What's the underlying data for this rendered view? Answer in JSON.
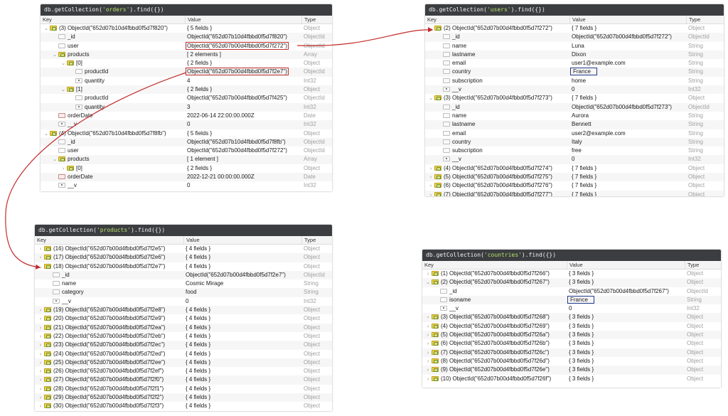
{
  "colors": {
    "accent_red": "#c22c2c",
    "accent_blue": "#1f3a8c",
    "query_bar": "#3b3d40"
  },
  "headers": {
    "key": "Key",
    "value": "Value",
    "type": "Type"
  },
  "orders": {
    "query_prefix": "db.getCollection(",
    "query_name": "'orders'",
    "query_suffix": ").find({})",
    "rows": [
      {
        "depth": 0,
        "arrow": "⌄",
        "icon": "doc",
        "key": "(3) ObjectId(\"652d07b10d4fbbd0f5d7f820\")",
        "value": "{ 5 fields }",
        "type": "Object"
      },
      {
        "depth": 1,
        "arrow": "",
        "icon": "field",
        "key": "_id",
        "value": "ObjectId(\"652d07b10d4fbbd0f5d7f820\")",
        "type": "ObjectId"
      },
      {
        "depth": 1,
        "arrow": "",
        "icon": "field",
        "key": "user",
        "value": "ObjectId(\"652d07b00d4fbbd0f5d7f272\")",
        "type": "ObjectId",
        "hl": "red"
      },
      {
        "depth": 1,
        "arrow": "⌄",
        "icon": "arr",
        "key": "products",
        "value": "[ 2 elements ]",
        "type": "Array"
      },
      {
        "depth": 2,
        "arrow": "⌄",
        "icon": "doc",
        "key": "[0]",
        "value": "{ 2 fields }",
        "type": "Object"
      },
      {
        "depth": 3,
        "arrow": "",
        "icon": "field",
        "key": "productId",
        "value": "ObjectId(\"652d07b00d4fbbd0f5d7f2e7\")",
        "type": "ObjectId",
        "hl": "red"
      },
      {
        "depth": 3,
        "arrow": "",
        "icon": "num",
        "key": "quantity",
        "value": "4",
        "type": "Int32"
      },
      {
        "depth": 2,
        "arrow": "⌄",
        "icon": "doc",
        "key": "[1]",
        "value": "{ 2 fields }",
        "type": "Object"
      },
      {
        "depth": 3,
        "arrow": "",
        "icon": "field",
        "key": "productId",
        "value": "ObjectId(\"652d07b00d4fbbd0f5d7f425\")",
        "type": "ObjectId"
      },
      {
        "depth": 3,
        "arrow": "",
        "icon": "num",
        "key": "quantity",
        "value": "3",
        "type": "Int32"
      },
      {
        "depth": 1,
        "arrow": "",
        "icon": "date",
        "key": "orderDate",
        "value": "2022-06-14 22:00:00.000Z",
        "type": "Date"
      },
      {
        "depth": 1,
        "arrow": "",
        "icon": "num",
        "key": "__v",
        "value": "0",
        "type": "Int32"
      },
      {
        "depth": 0,
        "arrow": "⌄",
        "icon": "doc",
        "key": "(4) ObjectId(\"652d07b10d4fbbd0f5d7f8fb\")",
        "value": "{ 5 fields }",
        "type": "Object"
      },
      {
        "depth": 1,
        "arrow": "",
        "icon": "field",
        "key": "_id",
        "value": "ObjectId(\"652d07b10d4fbbd0f5d7f8fb\")",
        "type": "ObjectId"
      },
      {
        "depth": 1,
        "arrow": "",
        "icon": "field",
        "key": "user",
        "value": "ObjectId(\"652d07b00d4fbbd0f5d7f272\")",
        "type": "ObjectId"
      },
      {
        "depth": 1,
        "arrow": "⌄",
        "icon": "arr",
        "key": "products",
        "value": "[ 1 element ]",
        "type": "Array"
      },
      {
        "depth": 2,
        "arrow": "›",
        "icon": "doc",
        "key": "[0]",
        "value": "{ 2 fields }",
        "type": "Object"
      },
      {
        "depth": 1,
        "arrow": "",
        "icon": "date",
        "key": "orderDate",
        "value": "2022-12-21 00:00:00.000Z",
        "type": "Date"
      },
      {
        "depth": 1,
        "arrow": "",
        "icon": "num",
        "key": "__v",
        "value": "0",
        "type": "Int32"
      }
    ]
  },
  "users": {
    "query_prefix": "db.getCollection(",
    "query_name": "'users'",
    "query_suffix": ").find({})",
    "rows": [
      {
        "depth": 0,
        "arrow": "⌄",
        "icon": "doc",
        "key": "(2) ObjectId(\"652d07b00d4fbbd0f5d7f272\")",
        "value": "{ 7 fields }",
        "type": "Object"
      },
      {
        "depth": 1,
        "arrow": "",
        "icon": "field",
        "key": "_id",
        "value": "ObjectId(\"652d07b00d4fbbd0f5d7f272\")",
        "type": "ObjectId"
      },
      {
        "depth": 1,
        "arrow": "",
        "icon": "field",
        "key": "name",
        "value": "Luna",
        "type": "String"
      },
      {
        "depth": 1,
        "arrow": "",
        "icon": "field",
        "key": "lastname",
        "value": "Dixon",
        "type": "String"
      },
      {
        "depth": 1,
        "arrow": "",
        "icon": "field",
        "key": "email",
        "value": "user1@example.com",
        "type": "String"
      },
      {
        "depth": 1,
        "arrow": "",
        "icon": "field",
        "key": "country",
        "value": "France",
        "type": "String",
        "hl": "blue"
      },
      {
        "depth": 1,
        "arrow": "",
        "icon": "field",
        "key": "subscription",
        "value": "home",
        "type": "String"
      },
      {
        "depth": 1,
        "arrow": "",
        "icon": "num",
        "key": "__v",
        "value": "0",
        "type": "Int32"
      },
      {
        "depth": 0,
        "arrow": "⌄",
        "icon": "doc",
        "key": "(3) ObjectId(\"652d07b00d4fbbd0f5d7f273\")",
        "value": "{ 7 fields }",
        "type": "Object"
      },
      {
        "depth": 1,
        "arrow": "",
        "icon": "field",
        "key": "_id",
        "value": "ObjectId(\"652d07b00d4fbbd0f5d7f273\")",
        "type": "ObjectId"
      },
      {
        "depth": 1,
        "arrow": "",
        "icon": "field",
        "key": "name",
        "value": "Aurora",
        "type": "String"
      },
      {
        "depth": 1,
        "arrow": "",
        "icon": "field",
        "key": "lastname",
        "value": "Bennett",
        "type": "String"
      },
      {
        "depth": 1,
        "arrow": "",
        "icon": "field",
        "key": "email",
        "value": "user2@example.com",
        "type": "String"
      },
      {
        "depth": 1,
        "arrow": "",
        "icon": "field",
        "key": "country",
        "value": "Italy",
        "type": "String"
      },
      {
        "depth": 1,
        "arrow": "",
        "icon": "field",
        "key": "subscription",
        "value": "free",
        "type": "String"
      },
      {
        "depth": 1,
        "arrow": "",
        "icon": "num",
        "key": "__v",
        "value": "0",
        "type": "Int32"
      },
      {
        "depth": 0,
        "arrow": "›",
        "icon": "doc",
        "key": "(4) ObjectId(\"652d07b00d4fbbd0f5d7f274\")",
        "value": "{ 7 fields }",
        "type": "Object"
      },
      {
        "depth": 0,
        "arrow": "›",
        "icon": "doc",
        "key": "(5) ObjectId(\"652d07b00d4fbbd0f5d7f275\")",
        "value": "{ 7 fields }",
        "type": "Object"
      },
      {
        "depth": 0,
        "arrow": "›",
        "icon": "doc",
        "key": "(6) ObjectId(\"652d07b00d4fbbd0f5d7f276\")",
        "value": "{ 7 fields }",
        "type": "Object"
      },
      {
        "depth": 0,
        "arrow": "›",
        "icon": "doc",
        "key": "(7) ObjectId(\"652d07b00d4fbbd0f5d7f277\")",
        "value": "{ 7 fields }",
        "type": "Object"
      }
    ]
  },
  "products": {
    "query_prefix": "db.getCollection(",
    "query_name": "'products'",
    "query_suffix": ").find({})",
    "rows": [
      {
        "depth": 0,
        "arrow": "›",
        "icon": "doc",
        "key": "(16) ObjectId(\"652d07b00d4fbbd0f5d7f2e5\")",
        "value": "{ 4 fields }",
        "type": "Object"
      },
      {
        "depth": 0,
        "arrow": "›",
        "icon": "doc",
        "key": "(17) ObjectId(\"652d07b00d4fbbd0f5d7f2e6\")",
        "value": "{ 4 fields }",
        "type": "Object"
      },
      {
        "depth": 0,
        "arrow": "⌄",
        "icon": "doc",
        "key": "(18) ObjectId(\"652d07b00d4fbbd0f5d7f2e7\")",
        "value": "{ 4 fields }",
        "type": "Object"
      },
      {
        "depth": 1,
        "arrow": "",
        "icon": "field",
        "key": "_id",
        "value": "ObjectId(\"652d07b00d4fbbd0f5d7f2e7\")",
        "type": "ObjectId"
      },
      {
        "depth": 1,
        "arrow": "",
        "icon": "field",
        "key": "name",
        "value": "Cosmic Mirage",
        "type": "String"
      },
      {
        "depth": 1,
        "arrow": "",
        "icon": "field",
        "key": "category",
        "value": "food",
        "type": "String"
      },
      {
        "depth": 1,
        "arrow": "",
        "icon": "num",
        "key": "__v",
        "value": "0",
        "type": "Int32"
      },
      {
        "depth": 0,
        "arrow": "›",
        "icon": "doc",
        "key": "(19) ObjectId(\"652d07b00d4fbbd0f5d7f2e8\")",
        "value": "{ 4 fields }",
        "type": "Object"
      },
      {
        "depth": 0,
        "arrow": "›",
        "icon": "doc",
        "key": "(20) ObjectId(\"652d07b00d4fbbd0f5d7f2e9\")",
        "value": "{ 4 fields }",
        "type": "Object"
      },
      {
        "depth": 0,
        "arrow": "›",
        "icon": "doc",
        "key": "(21) ObjectId(\"652d07b00d4fbbd0f5d7f2ea\")",
        "value": "{ 4 fields }",
        "type": "Object"
      },
      {
        "depth": 0,
        "arrow": "›",
        "icon": "doc",
        "key": "(22) ObjectId(\"652d07b00d4fbbd0f5d7f2eb\")",
        "value": "{ 4 fields }",
        "type": "Object"
      },
      {
        "depth": 0,
        "arrow": "›",
        "icon": "doc",
        "key": "(23) ObjectId(\"652d07b00d4fbbd0f5d7f2ec\")",
        "value": "{ 4 fields }",
        "type": "Object"
      },
      {
        "depth": 0,
        "arrow": "›",
        "icon": "doc",
        "key": "(24) ObjectId(\"652d07b00d4fbbd0f5d7f2ed\")",
        "value": "{ 4 fields }",
        "type": "Object"
      },
      {
        "depth": 0,
        "arrow": "›",
        "icon": "doc",
        "key": "(25) ObjectId(\"652d07b00d4fbbd0f5d7f2ee\")",
        "value": "{ 4 fields }",
        "type": "Object"
      },
      {
        "depth": 0,
        "arrow": "›",
        "icon": "doc",
        "key": "(26) ObjectId(\"652d07b00d4fbbd0f5d7f2ef\")",
        "value": "{ 4 fields }",
        "type": "Object"
      },
      {
        "depth": 0,
        "arrow": "›",
        "icon": "doc",
        "key": "(27) ObjectId(\"652d07b00d4fbbd0f5d7f2f0\")",
        "value": "{ 4 fields }",
        "type": "Object"
      },
      {
        "depth": 0,
        "arrow": "›",
        "icon": "doc",
        "key": "(28) ObjectId(\"652d07b00d4fbbd0f5d7f2f1\")",
        "value": "{ 4 fields }",
        "type": "Object"
      },
      {
        "depth": 0,
        "arrow": "›",
        "icon": "doc",
        "key": "(29) ObjectId(\"652d07b00d4fbbd0f5d7f2f2\")",
        "value": "{ 4 fields }",
        "type": "Object"
      },
      {
        "depth": 0,
        "arrow": "›",
        "icon": "doc",
        "key": "(30) ObjectId(\"652d07b00d4fbbd0f5d7f2f3\")",
        "value": "{ 4 fields }",
        "type": "Object"
      }
    ]
  },
  "countries": {
    "query_prefix": "db.getCollection(",
    "query_name": "'countries'",
    "query_suffix": ").find({})",
    "rows": [
      {
        "depth": 0,
        "arrow": "›",
        "icon": "doc",
        "key": "(1) ObjectId(\"652d07b00d4fbbd0f5d7f266\")",
        "value": "{ 3 fields }",
        "type": "Object"
      },
      {
        "depth": 0,
        "arrow": "⌄",
        "icon": "doc",
        "key": "(2) ObjectId(\"652d07b00d4fbbd0f5d7f267\")",
        "value": "{ 3 fields }",
        "type": "Object"
      },
      {
        "depth": 1,
        "arrow": "",
        "icon": "field",
        "key": "_id",
        "value": "ObjectId(\"652d07b00d4fbbd0f5d7f267\")",
        "type": "ObjectId"
      },
      {
        "depth": 1,
        "arrow": "",
        "icon": "field",
        "key": "isoname",
        "value": "France",
        "type": "String",
        "hl": "blue"
      },
      {
        "depth": 1,
        "arrow": "",
        "icon": "num",
        "key": "__v",
        "value": "0",
        "type": "Int32"
      },
      {
        "depth": 0,
        "arrow": "›",
        "icon": "doc",
        "key": "(3) ObjectId(\"652d07b00d4fbbd0f5d7f268\")",
        "value": "{ 3 fields }",
        "type": "Object"
      },
      {
        "depth": 0,
        "arrow": "›",
        "icon": "doc",
        "key": "(4) ObjectId(\"652d07b00d4fbbd0f5d7f269\")",
        "value": "{ 3 fields }",
        "type": "Object"
      },
      {
        "depth": 0,
        "arrow": "›",
        "icon": "doc",
        "key": "(5) ObjectId(\"652d07b00d4fbbd0f5d7f26a\")",
        "value": "{ 3 fields }",
        "type": "Object"
      },
      {
        "depth": 0,
        "arrow": "›",
        "icon": "doc",
        "key": "(6) ObjectId(\"652d07b00d4fbbd0f5d7f26b\")",
        "value": "{ 3 fields }",
        "type": "Object"
      },
      {
        "depth": 0,
        "arrow": "›",
        "icon": "doc",
        "key": "(7) ObjectId(\"652d07b00d4fbbd0f5d7f26c\")",
        "value": "{ 3 fields }",
        "type": "Object"
      },
      {
        "depth": 0,
        "arrow": "›",
        "icon": "doc",
        "key": "(8) ObjectId(\"652d07b00d4fbbd0f5d7f26d\")",
        "value": "{ 3 fields }",
        "type": "Object"
      },
      {
        "depth": 0,
        "arrow": "›",
        "icon": "doc",
        "key": "(9) ObjectId(\"652d07b00d4fbbd0f5d7f26e\")",
        "value": "{ 3 fields }",
        "type": "Object"
      },
      {
        "depth": 0,
        "arrow": "›",
        "icon": "doc",
        "key": "(10) ObjectId(\"652d07b00d4fbbd0f5d7f26f\")",
        "value": "{ 3 fields }",
        "type": "Object"
      }
    ]
  }
}
